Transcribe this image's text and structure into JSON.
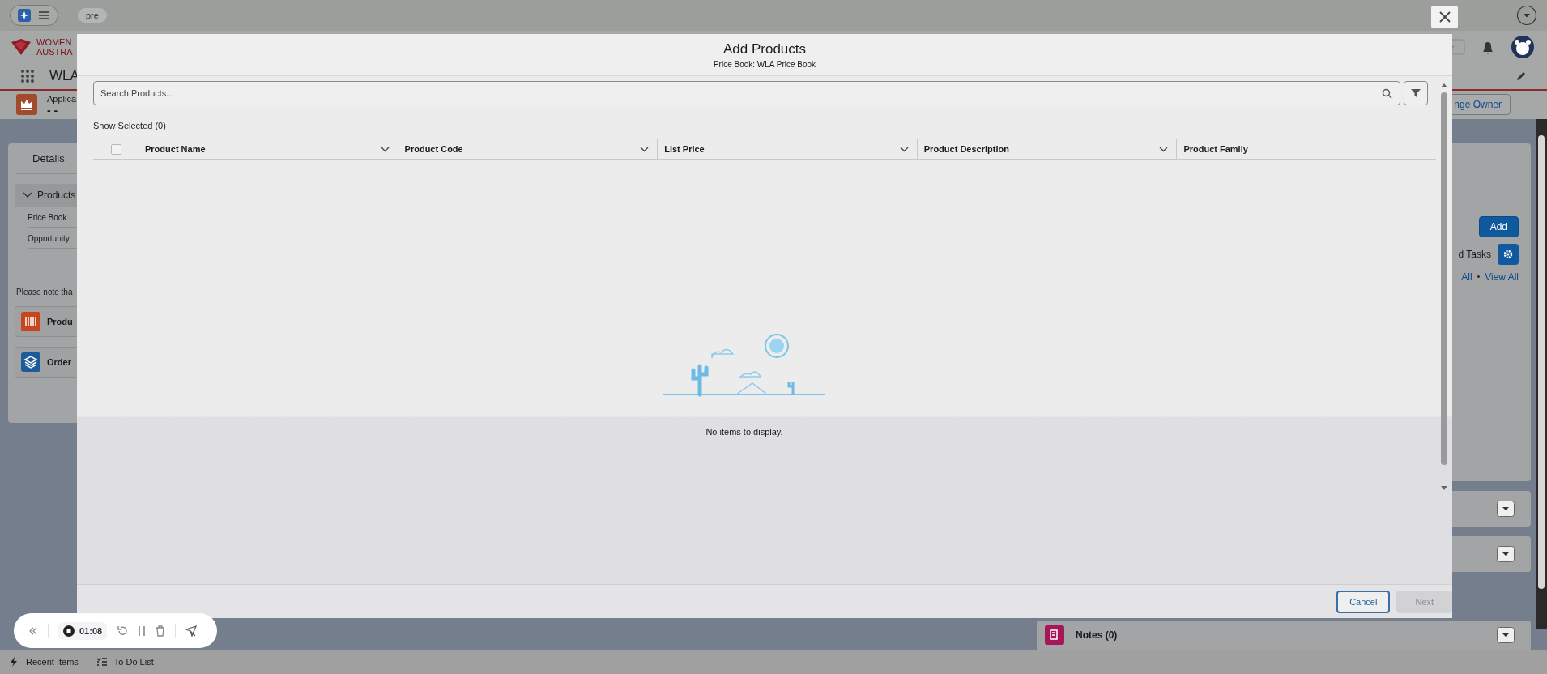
{
  "top_bar": {
    "badge": "pre"
  },
  "header": {
    "logo_lines": [
      "WOMEN",
      "AUSTRA"
    ],
    "app_name": "WLA",
    "record_type": "Applica",
    "record_name": "- -",
    "change_owner": "nge Owner"
  },
  "left_panel": {
    "tab": "Details",
    "section": "Products",
    "fields": [
      "Price Book",
      "Opportunity"
    ],
    "note": "Please note tha",
    "related": [
      {
        "title": "Produ",
        "kind": "products"
      },
      {
        "title": "Order",
        "kind": "orders"
      }
    ]
  },
  "right_panel": {
    "add_button": "Add",
    "tasks_label": "d Tasks",
    "links": [
      "All",
      "View All"
    ],
    "separator": "•",
    "notes": "Notes (0)"
  },
  "modal": {
    "title": "Add Products",
    "subtitle": "Price Book: WLA Price Book",
    "search": {
      "placeholder": "Search Products..."
    },
    "show_selected": "Show Selected (0)",
    "select_all": {
      "checked": false
    },
    "columns": [
      "Product Name",
      "Product Code",
      "List Price",
      "Product Description",
      "Product Family"
    ],
    "empty_message": "No items to display.",
    "buttons": [
      {
        "label": "Cancel",
        "focused": true,
        "disabled": false
      },
      {
        "label": "Next",
        "focused": false,
        "disabled": true
      }
    ]
  },
  "recorder": {
    "time": "01:08"
  },
  "utility_bar": [
    "Recent Items",
    "To Do List"
  ]
}
